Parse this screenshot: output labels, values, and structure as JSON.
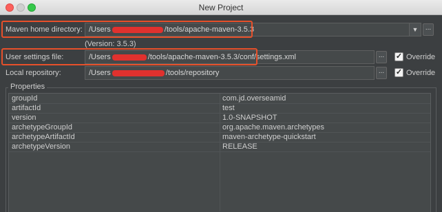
{
  "window": {
    "title": "New Project"
  },
  "maven_home": {
    "label": "Maven home directory:",
    "value_prefix": "/Users",
    "value_suffix": "/tools/apache-maven-3.5.3",
    "version": "(Version: 3.5.3)",
    "dropdown_icon": "chevron-down-icon",
    "browse_label": "..."
  },
  "user_settings": {
    "label": "User settings file:",
    "value_prefix": "/Users",
    "value_suffix": "/tools/apache-maven-3.5.3/conf/settings.xml",
    "browse_label": "...",
    "override_label": "Override",
    "override_checked": true
  },
  "local_repo": {
    "label": "Local repository:",
    "value_prefix": "/Users",
    "value_suffix": "/tools/repository",
    "browse_label": "...",
    "override_label": "Override",
    "override_checked": true
  },
  "properties": {
    "title": "Properties",
    "rows": [
      {
        "key": "groupId",
        "value": "com.jd.overseamid"
      },
      {
        "key": "artifactId",
        "value": "test"
      },
      {
        "key": "version",
        "value": "1.0-SNAPSHOT"
      },
      {
        "key": "archetypeGroupId",
        "value": "org.apache.maven.archetypes"
      },
      {
        "key": "archetypeArtifactId",
        "value": "maven-archetype-quickstart"
      },
      {
        "key": "archetypeVersion",
        "value": "RELEASE"
      }
    ]
  },
  "colors": {
    "highlight": "#e8502a",
    "redaction": "#e0312e",
    "background": "#3c3f41"
  }
}
